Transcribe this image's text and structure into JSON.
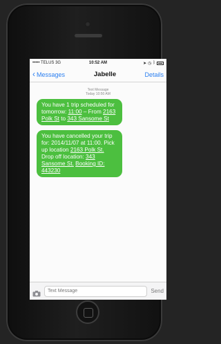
{
  "status_bar": {
    "carrier": "••••• TELUS  3G",
    "time": "10:52 AM",
    "right_icons": [
      "location-icon",
      "alarm-icon",
      "bluetooth-icon",
      "battery-icon"
    ]
  },
  "nav": {
    "back_label": "Messages",
    "title": "Jabelle",
    "details_label": "Details"
  },
  "thread": {
    "timestamp_line1": "Text Message",
    "timestamp_line2": "Today 10:50 AM",
    "messages": [
      {
        "part1": "You have 1 trip scheduled for tomorrow: ",
        "time_link": "11:00",
        "part2": " – From ",
        "from_link": "2163 Polk St",
        "part3": " to ",
        "to_link": "343 Sansome St"
      },
      {
        "part1": "You have cancelled your trip for: 2014/11/07 at 11:00. Pick up location ",
        "pickup_link": "2163 Polk St.",
        "part2": " Drop off location: ",
        "dropoff_link": "343 Sansome St.",
        "part3": " ",
        "booking_link": "Booking ID: 443230"
      }
    ]
  },
  "input_bar": {
    "placeholder": "Text Message",
    "send_label": "Send",
    "camera_icon": "camera-icon"
  },
  "colors": {
    "bubble": "#4cbf3f",
    "link_blue": "#2b7ff0"
  }
}
